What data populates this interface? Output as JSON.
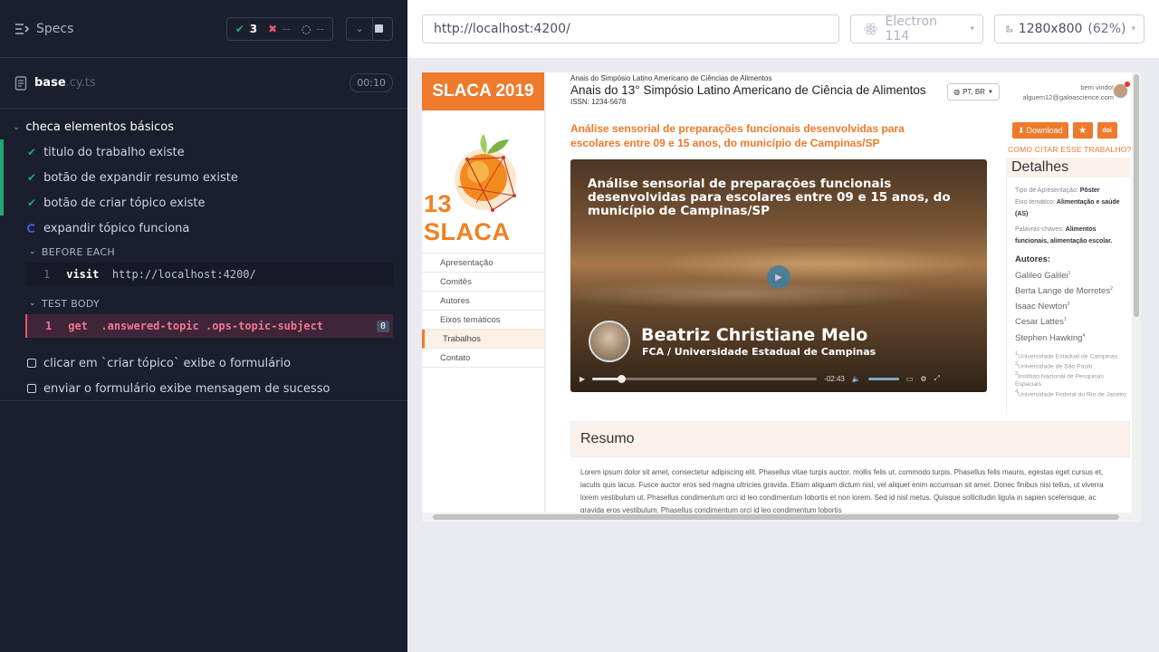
{
  "reporter": {
    "specs_label": "Specs",
    "passed": "3",
    "failed": "--",
    "pending": "--",
    "file_name": "base",
    "file_ext": ".cy.ts",
    "duration": "00:10",
    "suite": "checa elementos básicos",
    "tests": [
      {
        "label": "titulo do trabalho existe",
        "state": "passed"
      },
      {
        "label": "botão de expandir resumo existe",
        "state": "passed"
      },
      {
        "label": "botão de criar tópico existe",
        "state": "passed"
      },
      {
        "label": "expandir tópico funciona",
        "state": "running"
      },
      {
        "label": "clicar em `criar tópico` exibe o formulário",
        "state": "pending"
      },
      {
        "label": "enviar o formulário exibe mensagem de sucesso",
        "state": "pending"
      }
    ],
    "before_each": {
      "label": "BEFORE EACH",
      "cmd_num": "1",
      "cmd_name": "visit",
      "cmd_arg": "http://localhost:4200/"
    },
    "test_body": {
      "label": "TEST BODY",
      "cmd_num": "1",
      "cmd_name": "get",
      "cmd_arg": ".answered-topic .ops-topic-subject",
      "badge": "0"
    }
  },
  "aut": {
    "url": "http://localhost:4200/",
    "browser": "Electron 114",
    "viewport": "1280x800",
    "zoom": "(62%)"
  },
  "site": {
    "brand": "SLACA 2019",
    "logo_text": "13 SLACA",
    "nav": [
      "Apresentação",
      "Comitês",
      "Autores",
      "Eixos temáticos",
      "Trabalhos",
      "Contato"
    ],
    "nav_active": "Trabalhos",
    "head_small": "Anais do Simpósio Latino Americano de Ciências de Alimentos",
    "head_big": "Anais do 13° Simpósio Latino Americano de Ciência de Alimentos",
    "issn": "ISSN: 1234-5678",
    "lang": "PT, BR",
    "welcome": "bem vindo!",
    "email": "alguem12@galoascience.com",
    "article_title": "Análise sensorial de preparações funcionais desenvolvidas para escolares entre 09 e 15 anos, do município de Campinas/SP",
    "video": {
      "title": "Análise sensorial de preparações funcionais desenvolvidas para escolares entre 09 e 15 anos, do município de Campinas/SP",
      "presenter": "Beatriz Christiane Melo",
      "affiliation": "FCA / Universidade Estadual de Campinas",
      "time": "-02:43",
      "progress": 0.13
    },
    "download": "Download",
    "cite": "COMO CITAR ESSE TRABALHO?",
    "details": {
      "heading": "Detalhes",
      "type_label": "Tipo de Apresentação:",
      "type_value": "Pôster",
      "axis_label": "Eixo temático:",
      "axis_value": "Alimentação e saúde (AS)",
      "keywords_label": "Palavras-chaves:",
      "keywords_value": "Alimentos funcionais, alimentação escolar.",
      "authors_label": "Autores:",
      "authors": [
        "Galileo Galilei",
        "Berta Lange de Morretes",
        "Isaac Newton",
        "Cesar Lattes",
        "Stephen Hawking"
      ],
      "author_marks": [
        "1",
        "2",
        "3",
        "1",
        "4"
      ],
      "affiliations": [
        {
          "mark": "1",
          "text": "Universidade Estadual de Campinas"
        },
        {
          "mark": "2",
          "text": "Universidade de São Paulo"
        },
        {
          "mark": "3",
          "text": "Instituto Nacional de Pesquisas Espaciais"
        },
        {
          "mark": "4",
          "text": "Universidade Federal do Rio de Janeiro"
        }
      ]
    },
    "resumo_heading": "Resumo",
    "resumo_text": "Lorem ipsum dolor sit amet, consectetur adipiscing elit. Phasellus vitae turpis auctor, mollis felis ut, commodo turpis. Phasellus felis mauris, egestas eget cursus et, iaculis quis lacus. Fusce auctor eros sed magna ultricies gravida. Etiam aliquam dictum nisl, vel aliquet enim accumsan sit amet. Donec finibus nisi tellus, ut viverra lorem vestibulum ut. Phasellus condimentum orci id leo condimentum lobortis et non lorem. Sed id nisl metus. Quisque sollicitudin ligula in sapien scelerisque, ac gravida eros vestibulum. Phasellus condimentum orci id leo condimentum lobortis"
  },
  "colors": {
    "reporter_bg": "#1b1e2e",
    "pass": "#1fa971",
    "fail": "#e45770",
    "running": "#4956e3",
    "site_accent": "#ee7a2b"
  }
}
